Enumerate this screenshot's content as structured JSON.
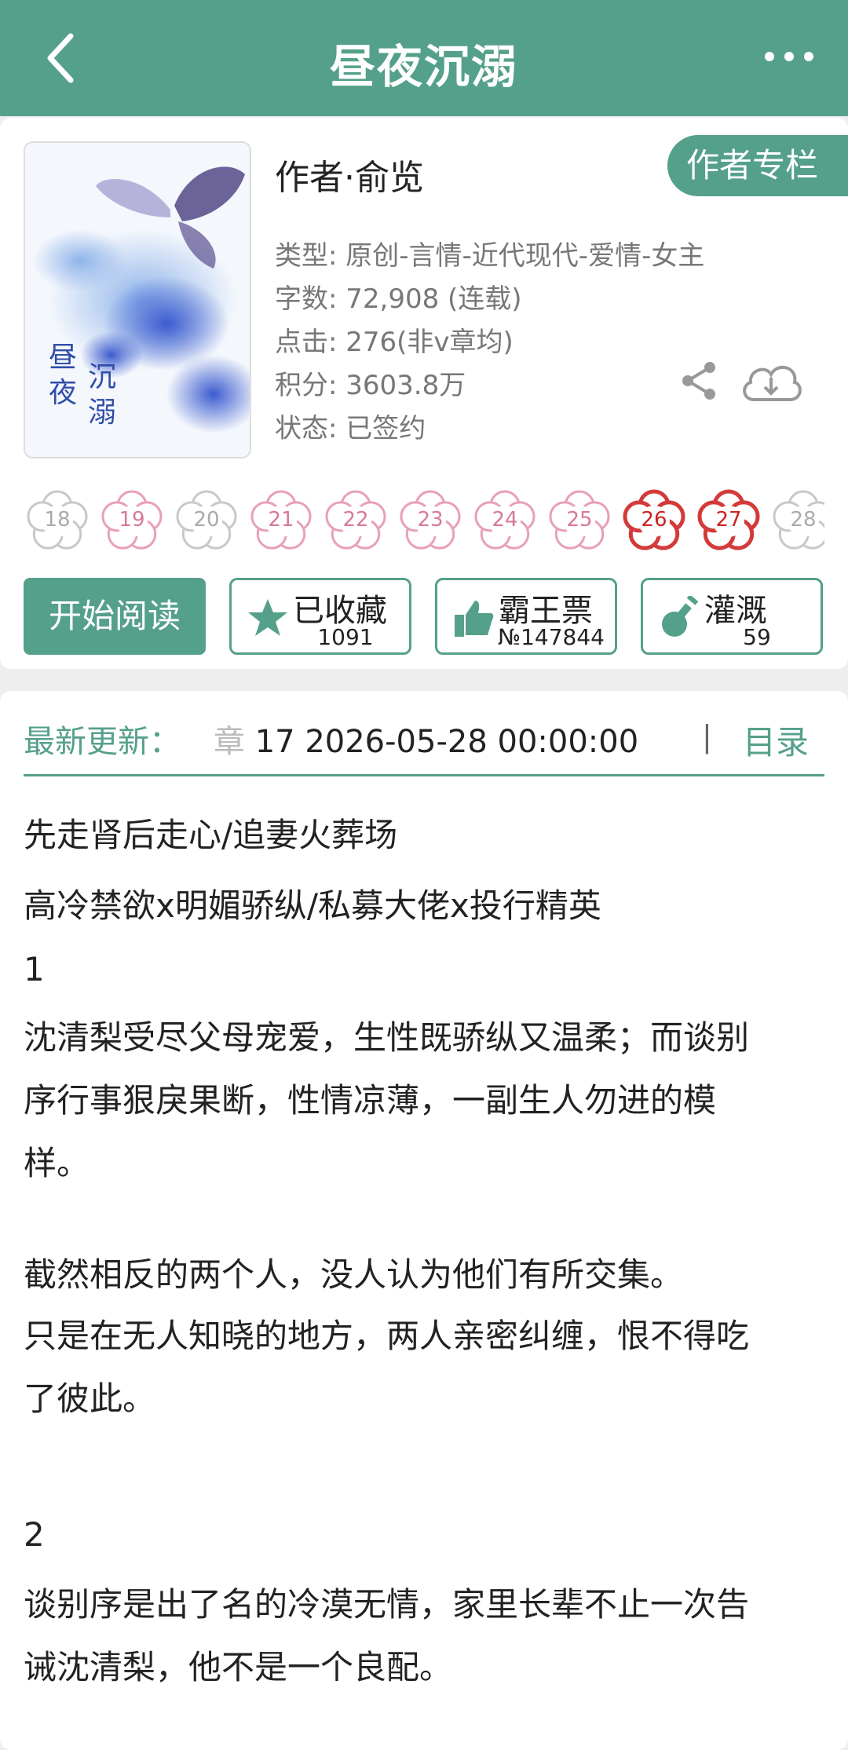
{
  "header": {
    "title": "昼夜沉溺",
    "back_icon": "chevron-left-icon",
    "more_icon": "more-dots-icon"
  },
  "book": {
    "cover_title": "昼夜沉溺",
    "author": "作者·俞览",
    "author_column_button": "作者专栏",
    "type": "类型: 原创-言情-近代现代-爱情-女主",
    "word_count": "字数: 72,908 (连载)",
    "clicks": "点击: 276(非v章均)",
    "score": "积分: 3603.8万",
    "status": "状态: 已签约"
  },
  "flowers": [
    {
      "num": "18",
      "state": "gray"
    },
    {
      "num": "19",
      "state": "pink"
    },
    {
      "num": "20",
      "state": "gray"
    },
    {
      "num": "21",
      "state": "pink"
    },
    {
      "num": "22",
      "state": "pink"
    },
    {
      "num": "23",
      "state": "pink"
    },
    {
      "num": "24",
      "state": "pink"
    },
    {
      "num": "25",
      "state": "pink"
    },
    {
      "num": "26",
      "state": "red"
    },
    {
      "num": "27",
      "state": "red"
    },
    {
      "num": "28",
      "state": "gray"
    }
  ],
  "actions": {
    "read": "开始阅读",
    "favorite": {
      "label": "已收藏",
      "count": "1091",
      "icon": "star-icon"
    },
    "ticket": {
      "label": "霸王票",
      "count": "№147844",
      "icon": "thumbs-up-icon"
    },
    "water": {
      "label": "灌溉",
      "count": "59",
      "icon": "watering-flask-icon"
    }
  },
  "latest": {
    "label": "最新更新：",
    "chapter_prefix": "章",
    "chapter_info": " 17  2026-05-28 00:00:00",
    "separator": "|",
    "toc": "目录"
  },
  "synopsis": [
    "先走肾后走心/追妻火葬场",
    "高冷禁欲x明媚骄纵/私募大佬x投行精英",
    "1",
    "沈清梨受尽父母宠爱，生性既骄纵又温柔；而谈别",
    "序行事狠戾果断，性情凉薄，一副生人勿进的模",
    "样。",
    "截然相反的两个人，没人认为他们有所交集。",
    "只是在无人知晓的地方，两人亲密纠缠，恨不得吃",
    "了彼此。",
    "2",
    "谈别序是出了名的冷漠无情，家里长辈不止一次告",
    "诫沈清梨，他不是一个良配。"
  ],
  "colors": {
    "accent": "#55a08b",
    "pink": "#e8a0b4",
    "red": "#d33a3a",
    "gray": "#c8c8c8"
  }
}
